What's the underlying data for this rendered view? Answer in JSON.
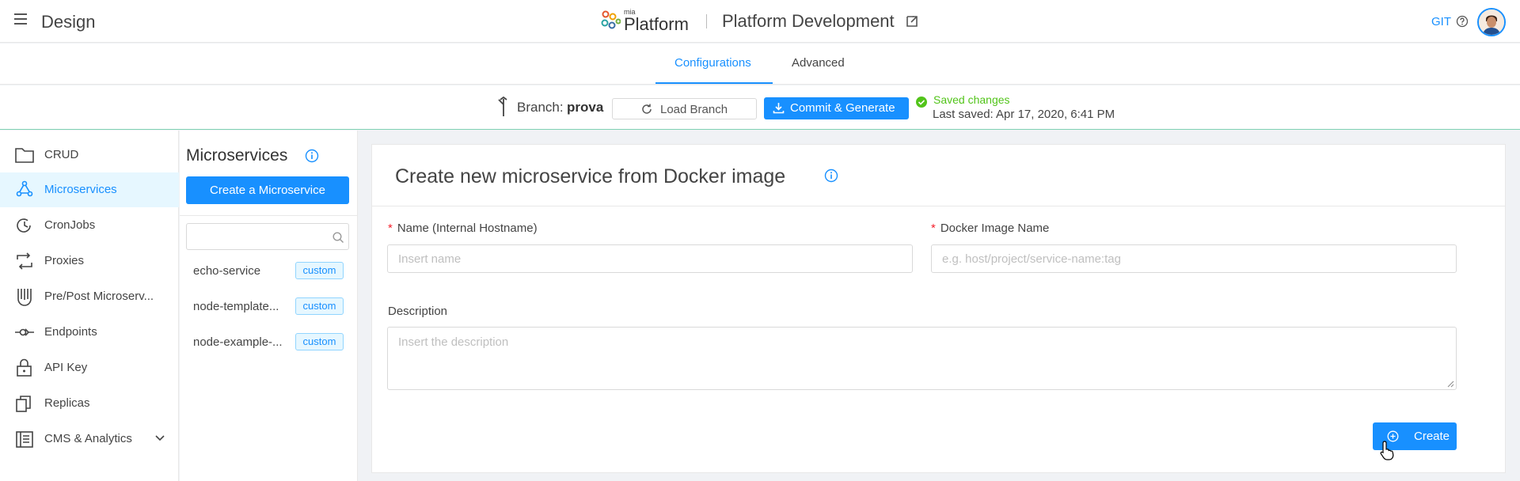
{
  "header": {
    "app_title": "Design",
    "logo_small": "mia",
    "logo_text": "Platform",
    "project_name": "Platform Development",
    "git_label": "GIT"
  },
  "tabs": [
    {
      "label": "Configurations",
      "active": true
    },
    {
      "label": "Advanced",
      "active": false
    }
  ],
  "branch_bar": {
    "branch_label": "Branch:",
    "branch_name": "prova",
    "load_label": "Load Branch",
    "commit_label": "Commit & Generate",
    "saved_status": "Saved changes",
    "last_saved": "Last saved:  Apr 17, 2020, 6:41 PM"
  },
  "sidebar": {
    "items": [
      {
        "label": "CRUD",
        "icon": "folder-icon",
        "active": false
      },
      {
        "label": "Microservices",
        "icon": "microservices-icon",
        "active": true
      },
      {
        "label": "CronJobs",
        "icon": "cronjob-icon",
        "active": false
      },
      {
        "label": "Proxies",
        "icon": "proxy-icon",
        "active": false
      },
      {
        "label": "Pre/Post Microserv...",
        "icon": "decorator-icon",
        "active": false
      },
      {
        "label": "Endpoints",
        "icon": "endpoint-icon",
        "active": false
      },
      {
        "label": "API Key",
        "icon": "lock-icon",
        "active": false
      },
      {
        "label": "Replicas",
        "icon": "replicas-icon",
        "active": false
      },
      {
        "label": "CMS & Analytics",
        "icon": "cms-icon",
        "active": false
      }
    ]
  },
  "microservices_panel": {
    "title": "Microservices",
    "create_label": "Create a Microservice",
    "search_value": "",
    "items": [
      {
        "name": "echo-service",
        "tag": "custom"
      },
      {
        "name": "node-template...",
        "tag": "custom"
      },
      {
        "name": "node-example-...",
        "tag": "custom"
      }
    ]
  },
  "form": {
    "title": "Create new microservice from Docker image",
    "name_label": "Name (Internal Hostname)",
    "name_placeholder": "Insert name",
    "image_label": "Docker Image Name",
    "image_placeholder": "e.g. host/project/service-name:tag",
    "description_label": "Description",
    "description_placeholder": "Insert the description",
    "required_mark": "*",
    "create_label": "Create"
  },
  "colors": {
    "accent": "#1890ff",
    "success": "#52c41a",
    "required": "#f5222d"
  }
}
